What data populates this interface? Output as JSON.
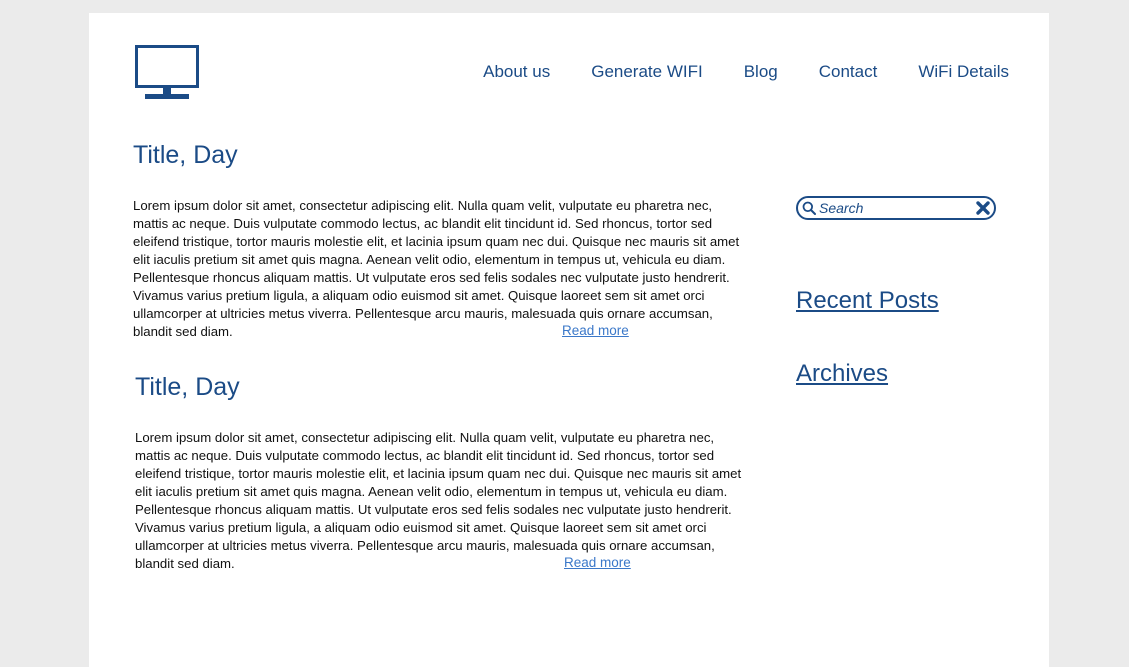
{
  "brand": {
    "logo_icon": "monitor-icon",
    "accent_color": "#1b4b86",
    "link_color": "#3b78c9"
  },
  "nav": {
    "items": [
      {
        "label": "About us"
      },
      {
        "label": "Generate WIFI"
      },
      {
        "label": "Blog"
      },
      {
        "label": "Contact"
      },
      {
        "label": "WiFi Details"
      }
    ]
  },
  "posts": [
    {
      "title": "Title, Day",
      "body": "Lorem ipsum dolor sit amet, consectetur adipiscing elit. Nulla quam velit, vulputate eu pharetra nec, mattis ac neque. Duis vulputate commodo lectus, ac blandit elit tincidunt id. Sed rhoncus, tortor sed eleifend tristique, tortor mauris molestie elit, et lacinia ipsum quam nec dui. Quisque nec mauris sit amet elit iaculis pretium sit amet quis magna. Aenean velit odio, elementum in tempus ut, vehicula eu diam. Pellentesque rhoncus aliquam mattis. Ut vulputate eros sed felis sodales nec vulputate justo hendrerit. Vivamus varius pretium ligula, a aliquam odio euismod sit amet. Quisque laoreet sem sit amet orci ullamcorper at ultricies metus viverra. Pellentesque arcu mauris, malesuada quis ornare accumsan, blandit sed diam.",
      "read_more": "Read more"
    },
    {
      "title": "Title, Day",
      "body": "Lorem ipsum dolor sit amet, consectetur adipiscing elit. Nulla quam velit, vulputate eu pharetra nec, mattis ac neque. Duis vulputate commodo lectus, ac blandit elit tincidunt id. Sed rhoncus, tortor sed eleifend tristique, tortor mauris molestie elit, et lacinia ipsum quam nec dui. Quisque nec mauris sit amet elit iaculis pretium sit amet quis magna. Aenean velit odio, elementum in tempus ut, vehicula eu diam. Pellentesque rhoncus aliquam mattis. Ut vulputate eros sed felis sodales nec vulputate justo hendrerit. Vivamus varius pretium ligula, a aliquam odio euismod sit amet. Quisque laoreet sem sit amet orci ullamcorper at ultricies metus viverra. Pellentesque arcu mauris, malesuada quis ornare accumsan, blandit sed diam.",
      "read_more": "Read more"
    }
  ],
  "sidebar": {
    "search": {
      "placeholder": "Search",
      "value": "",
      "search_icon": "search-icon",
      "clear_icon": "close-icon"
    },
    "links": [
      {
        "label": "Recent Posts"
      },
      {
        "label": "Archives"
      }
    ]
  }
}
